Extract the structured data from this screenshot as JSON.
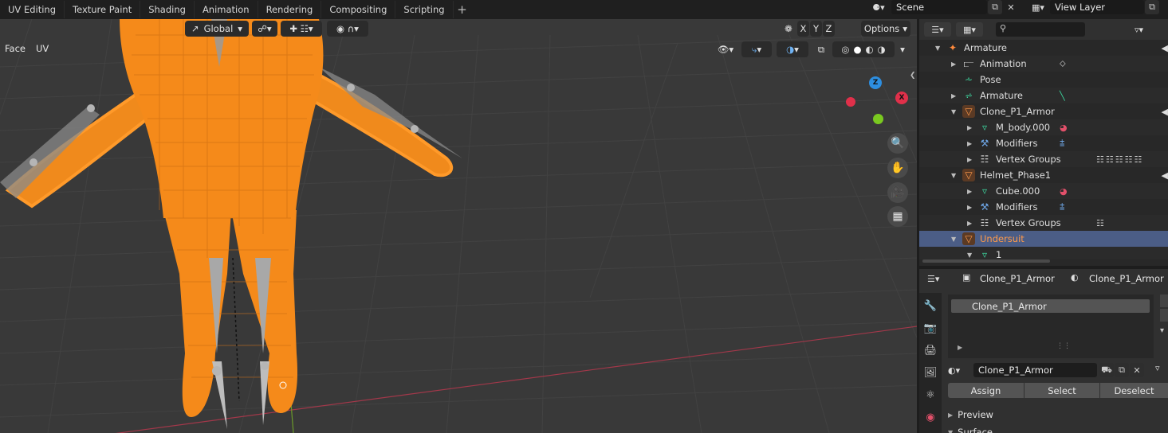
{
  "workspace_tabs": [
    "UV Editing",
    "Texture Paint",
    "Shading",
    "Animation",
    "Rendering",
    "Compositing",
    "Scripting"
  ],
  "scene": {
    "name": "Scene"
  },
  "view_layer": {
    "name": "View Layer"
  },
  "viewport": {
    "mode_menus": [
      "Face",
      "UV"
    ],
    "transform_orientation": "Global",
    "axis_buttons": [
      "X",
      "Y",
      "Z"
    ],
    "options_label": "Options",
    "gizmo_axes": {
      "x": "X",
      "y": "Y",
      "z": "Z"
    }
  },
  "outliner": {
    "search_placeholder": "",
    "rows": [
      {
        "label": "Armature",
        "icon": "armature-object-icon",
        "expanded": true,
        "depth": 0,
        "color": "#ff8a3c",
        "extra": ""
      },
      {
        "label": "Animation",
        "icon": "animation-icon",
        "expanded": false,
        "depth": 1,
        "color": "#c9c9c9",
        "extra": ""
      },
      {
        "label": "Pose",
        "icon": "pose-icon",
        "expanded": null,
        "depth": 1,
        "color": "#3dd9a0",
        "extra": ""
      },
      {
        "label": "Armature",
        "icon": "armature-data-icon",
        "expanded": false,
        "depth": 1,
        "color": "#3dd9a0",
        "extra": ""
      },
      {
        "label": "Clone_P1_Armor",
        "icon": "mesh-object-icon",
        "expanded": true,
        "depth": 1,
        "color": "#ff9a4a",
        "extra": ""
      },
      {
        "label": "M_body.000",
        "icon": "mesh-data-icon",
        "expanded": false,
        "depth": 2,
        "color": "#3dd9a0",
        "extra": ""
      },
      {
        "label": "Modifiers",
        "icon": "wrench-icon",
        "expanded": false,
        "depth": 2,
        "color": "#6ea6e6",
        "extra": ""
      },
      {
        "label": "Vertex Groups",
        "icon": "vertex-groups-icon",
        "expanded": false,
        "depth": 2,
        "color": "#cfcfcf",
        "extra": ""
      },
      {
        "label": "Helmet_Phase1",
        "icon": "mesh-object-icon",
        "expanded": true,
        "depth": 1,
        "color": "#ff9a4a",
        "extra": ""
      },
      {
        "label": "Cube.000",
        "icon": "mesh-data-icon",
        "expanded": false,
        "depth": 2,
        "color": "#3dd9a0",
        "extra": ""
      },
      {
        "label": "Modifiers",
        "icon": "wrench-icon",
        "expanded": false,
        "depth": 2,
        "color": "#6ea6e6",
        "extra": ""
      },
      {
        "label": "Vertex Groups",
        "icon": "vertex-groups-icon",
        "expanded": false,
        "depth": 2,
        "color": "#cfcfcf",
        "extra": ""
      },
      {
        "label": "Undersuit",
        "icon": "mesh-object-icon",
        "expanded": true,
        "depth": 1,
        "color": "#ff9a4a",
        "extra": "",
        "selected": true
      },
      {
        "label": "1",
        "icon": "mesh-data-icon",
        "expanded": true,
        "depth": 2,
        "color": "#3dd9a0",
        "extra": ""
      }
    ]
  },
  "properties": {
    "breadcrumb_object": "Clone_P1_Armor",
    "breadcrumb_material": "Clone_P1_Armor",
    "material_slot": "Clone_P1_Armor",
    "material_name": "Clone_P1_Armor",
    "assign_label": "Assign",
    "select_label": "Select",
    "deselect_label": "Deselect",
    "preview_label": "Preview",
    "surface_label": "Surface"
  },
  "colors": {
    "accent_selection": "#4b5d86",
    "mesh_orange": "#ff8a1c",
    "axis_x": "#e0304a",
    "axis_y": "#7ac920",
    "axis_z": "#2d8ee0"
  }
}
